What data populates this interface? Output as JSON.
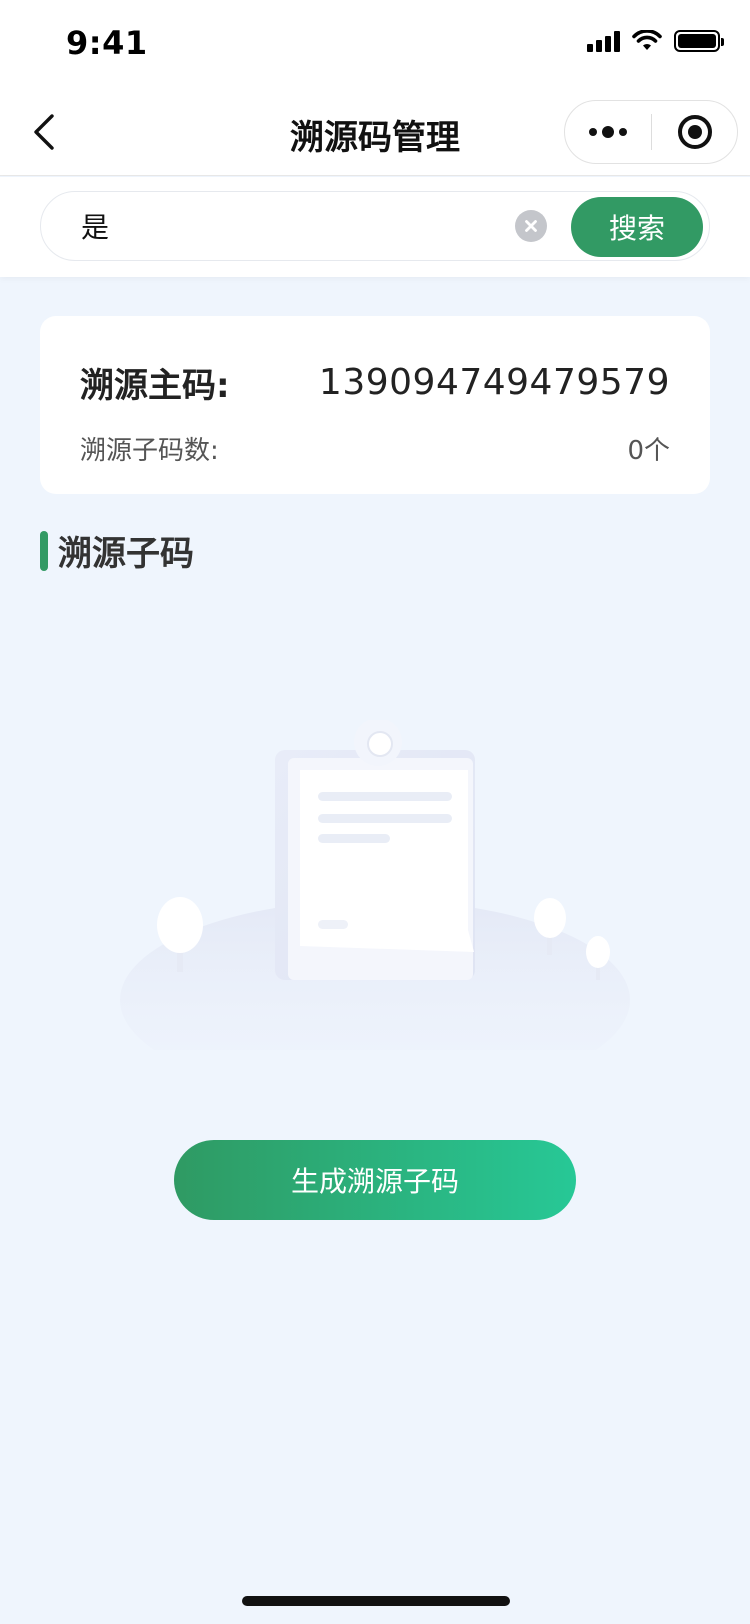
{
  "status_bar": {
    "time": "9:41"
  },
  "nav": {
    "title": "溯源码管理"
  },
  "search": {
    "value": "是",
    "button_label": "搜索"
  },
  "info_card": {
    "master_code_label": "溯源主码:",
    "master_code_value": "139094749479579",
    "sub_code_count_label": "溯源子码数:",
    "sub_code_count_value": "0个"
  },
  "section": {
    "title": "溯源子码"
  },
  "actions": {
    "generate_label": "生成溯源子码"
  },
  "colors": {
    "accent": "#329a64",
    "gradient_end": "#27c896",
    "background": "#eff5fd"
  },
  "icons": {
    "back": "chevron-left-icon",
    "more": "more-dots-icon",
    "close_app": "target-circle-icon",
    "clear": "clear-circle-icon"
  }
}
